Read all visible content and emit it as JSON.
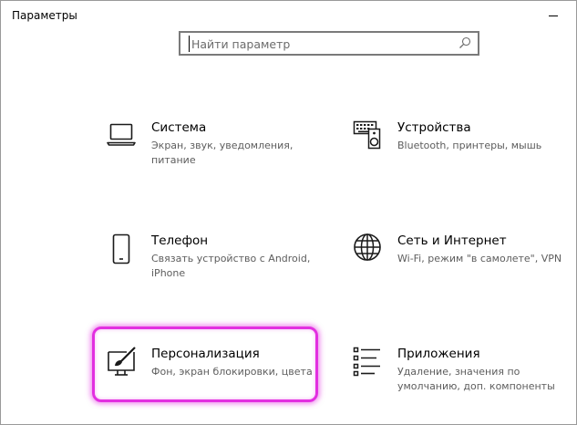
{
  "window": {
    "title": "Параметры"
  },
  "search": {
    "placeholder": "Найти параметр",
    "icon": "search-icon"
  },
  "tiles": [
    {
      "title": "Система",
      "description": "Экран, звук, уведомления, питание",
      "icon": "laptop-icon"
    },
    {
      "title": "Устройства",
      "description": "Bluetooth, принтеры, мышь",
      "icon": "devices-icon"
    },
    {
      "title": "Телефон",
      "description": "Связать устройство с Android, iPhone",
      "icon": "phone-icon"
    },
    {
      "title": "Сеть и Интернет",
      "description": "Wi-Fi, режим \"в самолете\", VPN",
      "icon": "globe-icon"
    },
    {
      "title": "Персонализация",
      "description": "Фон, экран блокировки, цвета",
      "icon": "personalization-icon",
      "highlighted": true
    },
    {
      "title": "Приложения",
      "description": "Удаление, значения по умолчанию, доп. компоненты",
      "icon": "apps-list-icon"
    }
  ],
  "colors": {
    "highlight": "#e22fe0",
    "description_text": "#5d5d5d",
    "search_border": "#7a7a7a"
  }
}
